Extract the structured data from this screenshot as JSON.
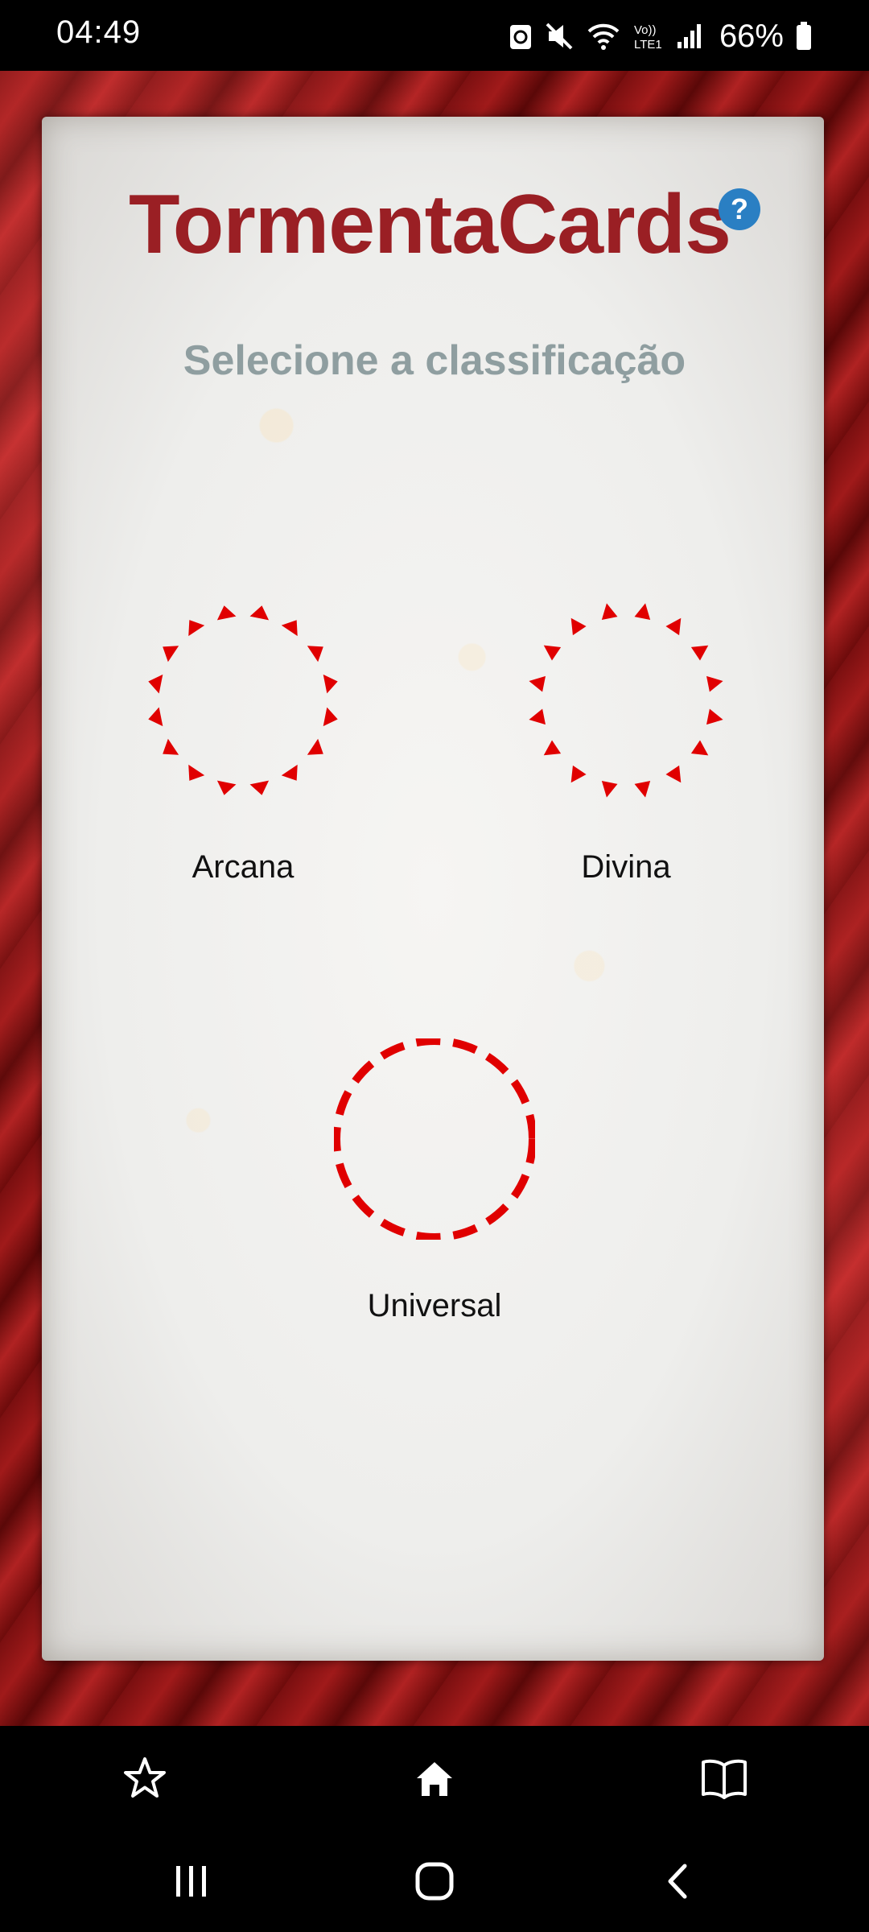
{
  "status_bar": {
    "time": "04:49",
    "battery": "66%",
    "icons": [
      "sync-icon",
      "mute-icon",
      "wifi-icon",
      "volte-icon",
      "signal-icon",
      "battery-icon"
    ]
  },
  "header": {
    "title": "TormentaCards",
    "help_label": "?"
  },
  "subtitle": "Selecione a classificação",
  "options": [
    {
      "label": "Arcana",
      "icon": "arcana-circle-icon"
    },
    {
      "label": "Divina",
      "icon": "divina-circle-icon"
    },
    {
      "label": "Universal",
      "icon": "universal-circle-icon"
    }
  ],
  "bottom_nav": {
    "items": [
      "star-icon",
      "home-icon",
      "book-icon"
    ]
  },
  "system_nav": {
    "items": [
      "recent-apps-icon",
      "home-button-icon",
      "back-icon"
    ]
  },
  "colors": {
    "title": "#9a1f24",
    "accent_red": "#e00000",
    "help_blue": "#2a7fc3",
    "subtitle": "#8f9ea0"
  }
}
